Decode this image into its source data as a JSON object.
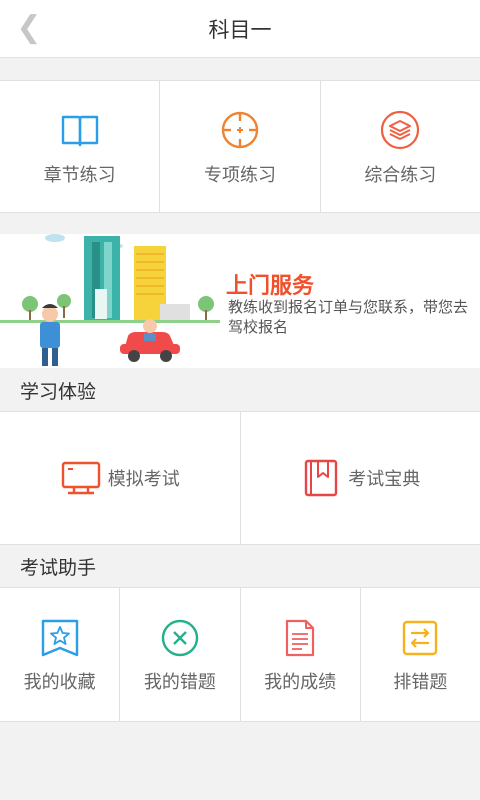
{
  "header": {
    "back_icon": "chevron-left-icon",
    "title": "科目一"
  },
  "practice": {
    "items": [
      {
        "label": "章节练习",
        "icon": "book-icon",
        "color": "#2a9ee8"
      },
      {
        "label": "专项练习",
        "icon": "crosshair-icon",
        "color": "#f08232"
      },
      {
        "label": "综合练习",
        "icon": "layers-icon",
        "color": "#f06040"
      }
    ]
  },
  "banner": {
    "title": "上门服务",
    "desc": "教练收到报名订单与您联系，带您去驾校报名"
  },
  "study": {
    "title": "学习体验",
    "items": [
      {
        "label": "模拟考试",
        "icon": "monitor-icon",
        "color": "#f0502c"
      },
      {
        "label": "考试宝典",
        "icon": "bookmark-book-icon",
        "color": "#e84646"
      }
    ]
  },
  "assistant": {
    "title": "考试助手",
    "items": [
      {
        "label": "我的收藏",
        "icon": "star-bookmark-icon",
        "color": "#2a9ee8"
      },
      {
        "label": "我的错题",
        "icon": "x-circle-icon",
        "color": "#23b08a"
      },
      {
        "label": "我的成绩",
        "icon": "document-icon",
        "color": "#f06060"
      },
      {
        "label": "排错题",
        "icon": "swap-icon",
        "color": "#f5b21a"
      }
    ]
  }
}
